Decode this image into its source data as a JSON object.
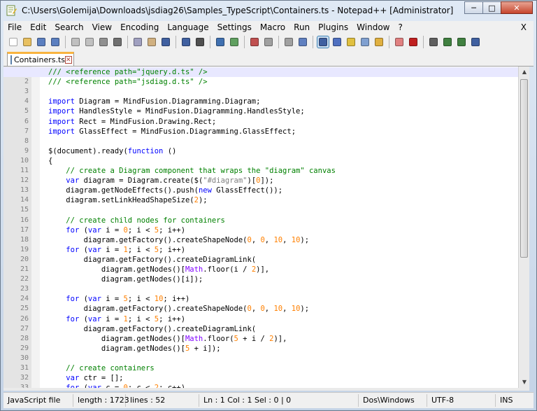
{
  "window": {
    "title": "C:\\Users\\Golemija\\Downloads\\jsdiag26\\Samples_TypeScript\\Containers.ts - Notepad++ [Administrator]",
    "minimize_label": "─",
    "maximize_label": "□",
    "close_label": "✕"
  },
  "menu": {
    "items": [
      "File",
      "Edit",
      "Search",
      "View",
      "Encoding",
      "Language",
      "Settings",
      "Macro",
      "Run",
      "Plugins",
      "Window",
      "?"
    ],
    "close_label": "X"
  },
  "toolbar": {
    "icons": [
      "new-file-icon",
      "open-file-icon",
      "save-icon",
      "save-all-icon",
      "close-icon",
      "close-all-icon",
      "print-icon",
      "cut-icon",
      "copy-icon",
      "paste-icon",
      "undo-icon",
      "redo-icon",
      "find-icon",
      "replace-icon",
      "zoom-in-icon",
      "zoom-out-icon",
      "sync-v-icon",
      "sync-h-icon",
      "word-wrap-icon",
      "show-all-chars-icon",
      "indent-guide-icon",
      "doc-map-icon",
      "function-list-icon",
      "folder-workspace-icon",
      "monitoring-icon",
      "record-macro-icon",
      "stop-record-icon",
      "play-macro-icon",
      "run-macro-multiple-icon",
      "save-macro-icon"
    ]
  },
  "tab": {
    "label": "Containers.ts",
    "close_label": "✕"
  },
  "editor": {
    "lines": [
      [
        [
          "com",
          "/// <reference path=\"jquery.d.ts\" />"
        ]
      ],
      [
        [
          "com",
          "/// <reference path=\"jsdiag.d.ts\" />"
        ]
      ],
      [],
      [
        [
          "kw",
          "import"
        ],
        [
          "txt",
          " Diagram = MindFusion.Diagramming.Diagram;"
        ]
      ],
      [
        [
          "kw",
          "import"
        ],
        [
          "txt",
          " HandlesStyle = MindFusion.Diagramming.HandlesStyle;"
        ]
      ],
      [
        [
          "kw",
          "import"
        ],
        [
          "txt",
          " Rect = MindFusion.Drawing.Rect;"
        ]
      ],
      [
        [
          "kw",
          "import"
        ],
        [
          "txt",
          " GlassEffect = MindFusion.Diagramming.GlassEffect;"
        ]
      ],
      [],
      [
        [
          "txt",
          "$(document).ready("
        ],
        [
          "kw",
          "function"
        ],
        [
          "txt",
          " ()"
        ]
      ],
      [
        [
          "txt",
          "{"
        ]
      ],
      [
        [
          "txt",
          "    "
        ],
        [
          "com",
          "// create a Diagram component that wraps the \"diagram\" canvas"
        ]
      ],
      [
        [
          "txt",
          "    "
        ],
        [
          "kw",
          "var"
        ],
        [
          "txt",
          " diagram = Diagram.create($("
        ],
        [
          "str",
          "\"#diagram\""
        ],
        [
          "txt",
          ")["
        ],
        [
          "num",
          "0"
        ],
        [
          "txt",
          "]);"
        ]
      ],
      [
        [
          "txt",
          "    diagram.getNodeEffects().push("
        ],
        [
          "kw",
          "new"
        ],
        [
          "txt",
          " GlassEffect());"
        ]
      ],
      [
        [
          "txt",
          "    diagram.setLinkHeadShapeSize("
        ],
        [
          "num",
          "2"
        ],
        [
          "txt",
          ");"
        ]
      ],
      [],
      [
        [
          "txt",
          "    "
        ],
        [
          "com",
          "// create child nodes for containers"
        ]
      ],
      [
        [
          "txt",
          "    "
        ],
        [
          "kw",
          "for"
        ],
        [
          "txt",
          " ("
        ],
        [
          "kw",
          "var"
        ],
        [
          "txt",
          " i = "
        ],
        [
          "num",
          "0"
        ],
        [
          "txt",
          "; i < "
        ],
        [
          "num",
          "5"
        ],
        [
          "txt",
          "; i++)"
        ]
      ],
      [
        [
          "txt",
          "        diagram.getFactory().createShapeNode("
        ],
        [
          "num",
          "0"
        ],
        [
          "txt",
          ", "
        ],
        [
          "num",
          "0"
        ],
        [
          "txt",
          ", "
        ],
        [
          "num",
          "10"
        ],
        [
          "txt",
          ", "
        ],
        [
          "num",
          "10"
        ],
        [
          "txt",
          ");"
        ]
      ],
      [
        [
          "txt",
          "    "
        ],
        [
          "kw",
          "for"
        ],
        [
          "txt",
          " ("
        ],
        [
          "kw",
          "var"
        ],
        [
          "txt",
          " i = "
        ],
        [
          "num",
          "1"
        ],
        [
          "txt",
          "; i < "
        ],
        [
          "num",
          "5"
        ],
        [
          "txt",
          "; i++)"
        ]
      ],
      [
        [
          "txt",
          "        diagram.getFactory().createDiagramLink("
        ]
      ],
      [
        [
          "txt",
          "            diagram.getNodes()["
        ],
        [
          "cls",
          "Math"
        ],
        [
          "txt",
          ".floor(i / "
        ],
        [
          "num",
          "2"
        ],
        [
          "txt",
          ")],"
        ]
      ],
      [
        [
          "txt",
          "            diagram.getNodes()[i]);"
        ]
      ],
      [],
      [
        [
          "txt",
          "    "
        ],
        [
          "kw",
          "for"
        ],
        [
          "txt",
          " ("
        ],
        [
          "kw",
          "var"
        ],
        [
          "txt",
          " i = "
        ],
        [
          "num",
          "5"
        ],
        [
          "txt",
          "; i < "
        ],
        [
          "num",
          "10"
        ],
        [
          "txt",
          "; i++)"
        ]
      ],
      [
        [
          "txt",
          "        diagram.getFactory().createShapeNode("
        ],
        [
          "num",
          "0"
        ],
        [
          "txt",
          ", "
        ],
        [
          "num",
          "0"
        ],
        [
          "txt",
          ", "
        ],
        [
          "num",
          "10"
        ],
        [
          "txt",
          ", "
        ],
        [
          "num",
          "10"
        ],
        [
          "txt",
          ");"
        ]
      ],
      [
        [
          "txt",
          "    "
        ],
        [
          "kw",
          "for"
        ],
        [
          "txt",
          " ("
        ],
        [
          "kw",
          "var"
        ],
        [
          "txt",
          " i = "
        ],
        [
          "num",
          "1"
        ],
        [
          "txt",
          "; i < "
        ],
        [
          "num",
          "5"
        ],
        [
          "txt",
          "; i++)"
        ]
      ],
      [
        [
          "txt",
          "        diagram.getFactory().createDiagramLink("
        ]
      ],
      [
        [
          "txt",
          "            diagram.getNodes()["
        ],
        [
          "cls",
          "Math"
        ],
        [
          "txt",
          ".floor("
        ],
        [
          "num",
          "5"
        ],
        [
          "txt",
          " + i / "
        ],
        [
          "num",
          "2"
        ],
        [
          "txt",
          ")],"
        ]
      ],
      [
        [
          "txt",
          "            diagram.getNodes()["
        ],
        [
          "num",
          "5"
        ],
        [
          "txt",
          " + i]);"
        ]
      ],
      [],
      [
        [
          "txt",
          "    "
        ],
        [
          "com",
          "// create containers"
        ]
      ],
      [
        [
          "txt",
          "    "
        ],
        [
          "kw",
          "var"
        ],
        [
          "txt",
          " ctr = [];"
        ]
      ],
      [
        [
          "txt",
          "    "
        ],
        [
          "kw",
          "for"
        ],
        [
          "txt",
          " ("
        ],
        [
          "kw",
          "var"
        ],
        [
          "txt",
          " c = "
        ],
        [
          "num",
          "0"
        ],
        [
          "txt",
          "; c < "
        ],
        [
          "num",
          "2"
        ],
        [
          "txt",
          "; c++)"
        ]
      ]
    ],
    "current_line": 1
  },
  "status": {
    "file_type": "JavaScript file",
    "length": "length : 1723",
    "lines": "lines : 52",
    "position": "Ln : 1    Col : 1    Sel : 0 | 0",
    "eol": "Dos\\Windows",
    "encoding": "UTF-8",
    "mode": "INS"
  }
}
